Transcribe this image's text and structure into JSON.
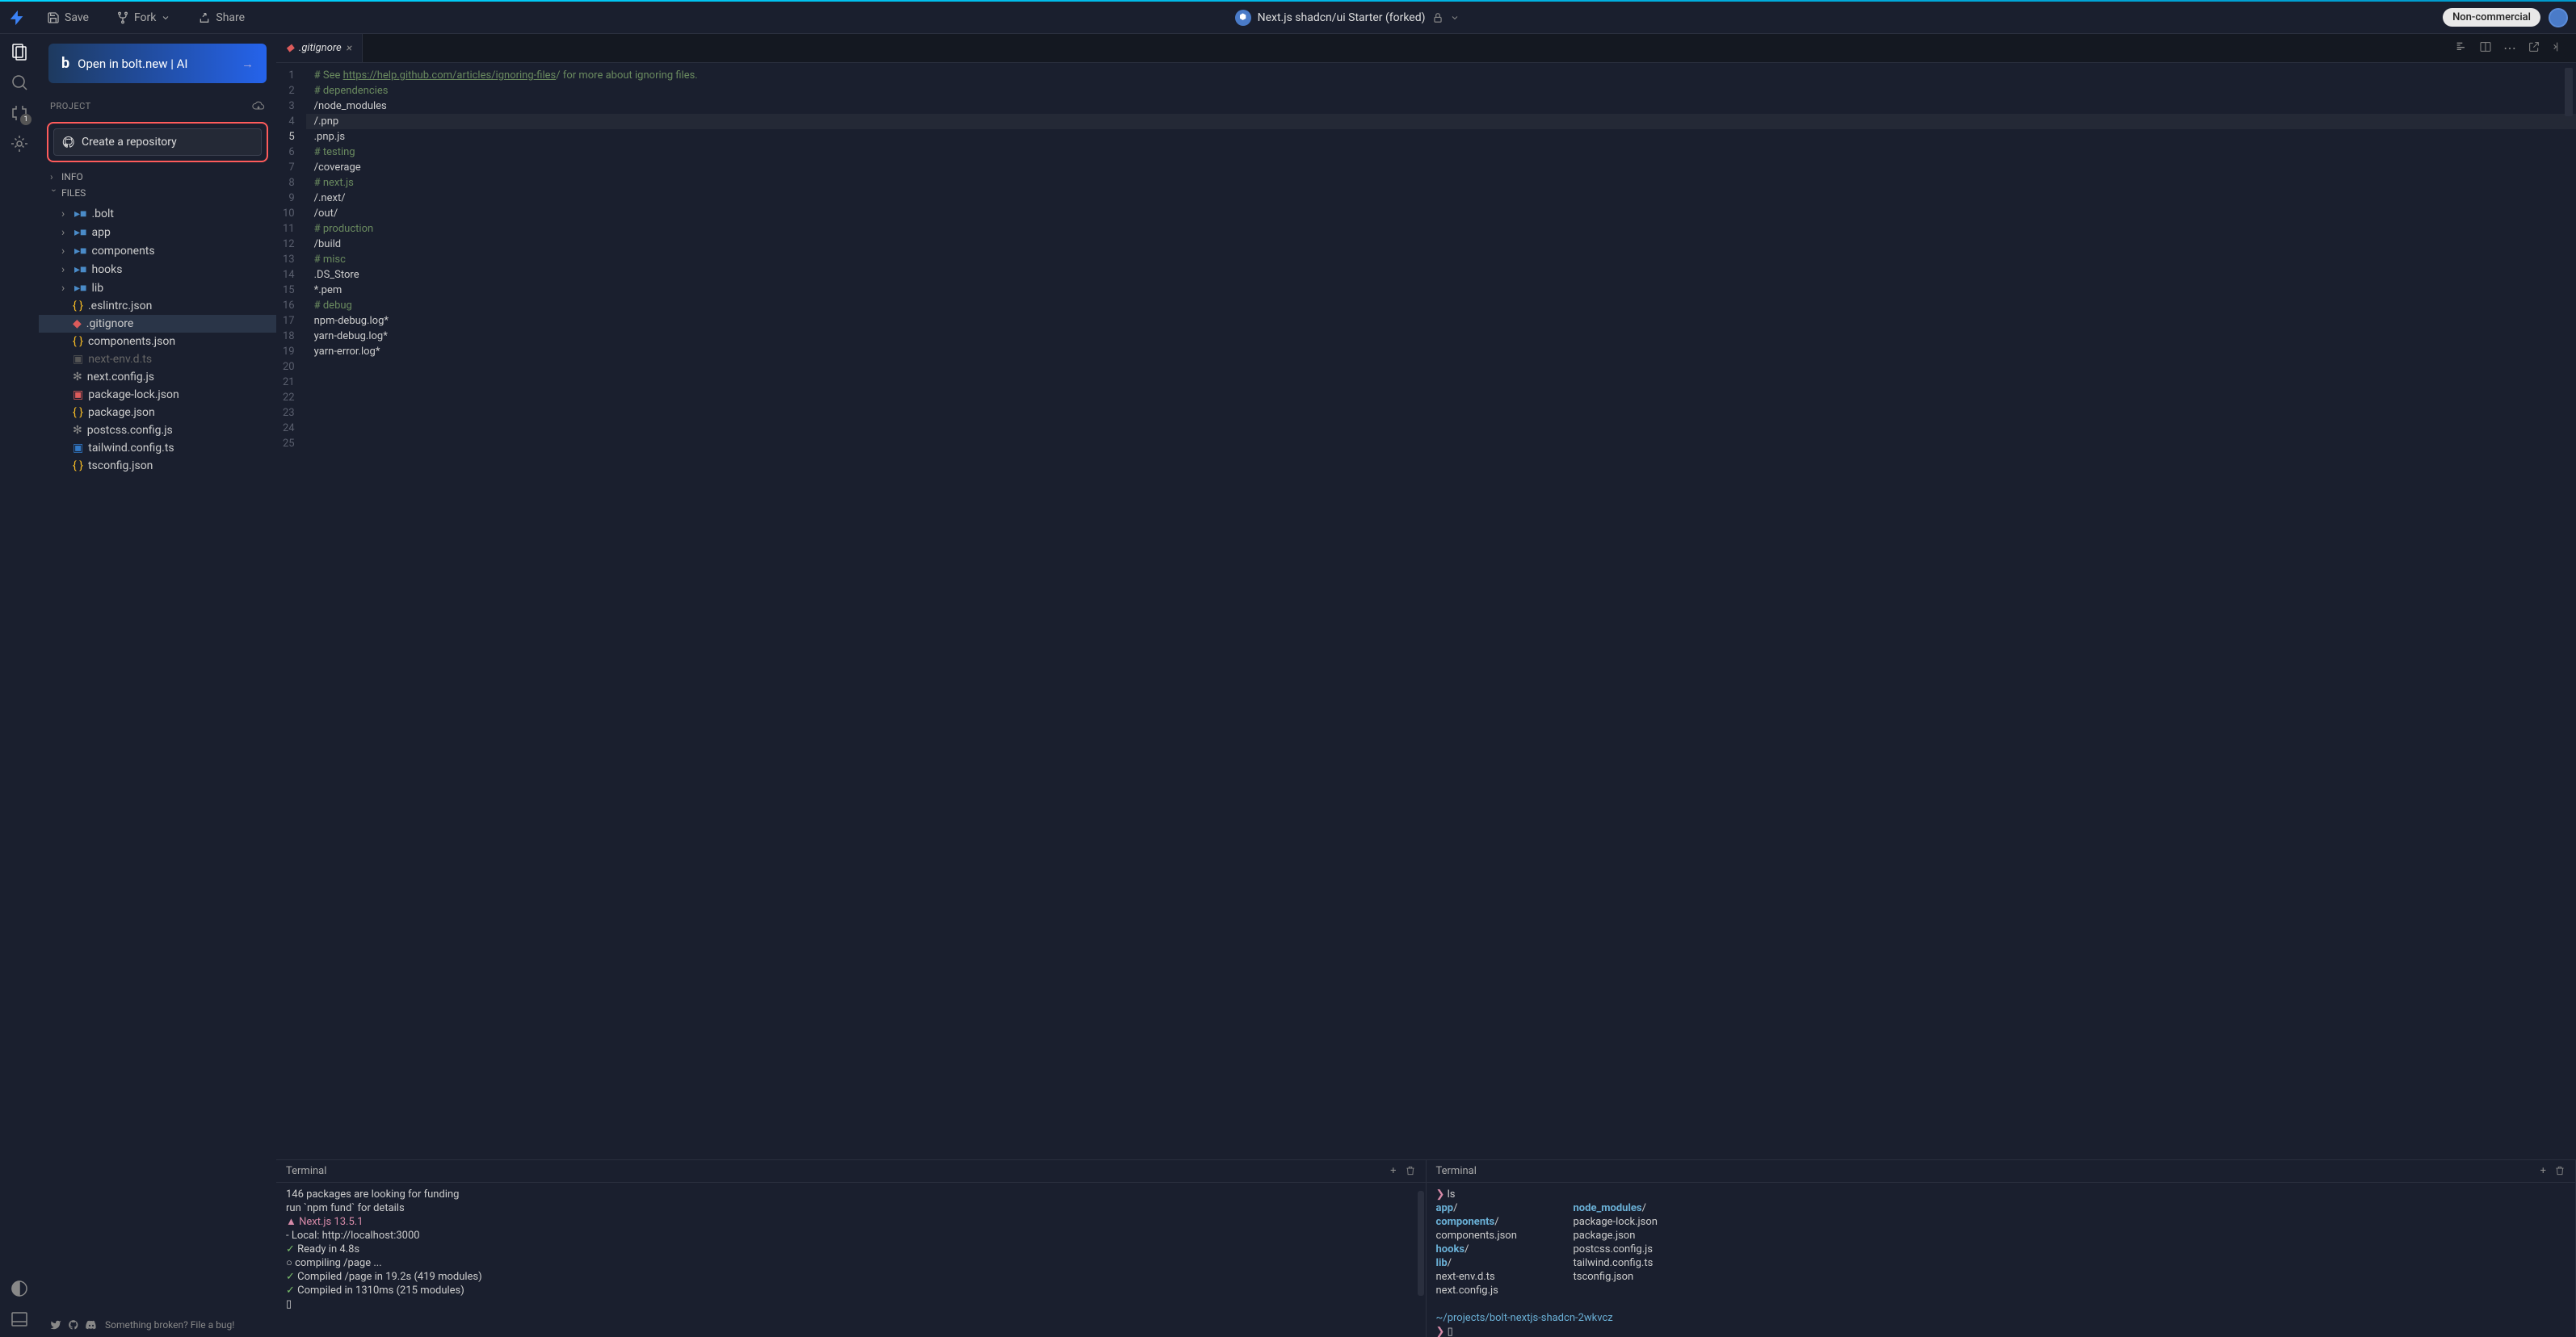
{
  "titlebar": {
    "save_label": "Save",
    "fork_label": "Fork",
    "share_label": "Share",
    "project_title": "Next.js shadcn/ui Starter (forked)",
    "badge": "Non-commercial"
  },
  "bolt_banner": {
    "label": "Open in bolt.new | AI"
  },
  "project": {
    "label": "PROJECT",
    "create_repo": "Create a repository",
    "info_label": "INFO",
    "files_label": "FILES"
  },
  "files": {
    "folders": [
      {
        "name": ".bolt"
      },
      {
        "name": "app"
      },
      {
        "name": "components"
      },
      {
        "name": "hooks"
      },
      {
        "name": "lib"
      }
    ],
    "files": [
      {
        "name": ".eslintrc.json",
        "icon": "json"
      },
      {
        "name": ".gitignore",
        "icon": "git",
        "selected": true
      },
      {
        "name": "components.json",
        "icon": "json"
      },
      {
        "name": "next-env.d.ts",
        "icon": "ts-dim",
        "dimmed": true
      },
      {
        "name": "next.config.js",
        "icon": "gear"
      },
      {
        "name": "package-lock.json",
        "icon": "lock"
      },
      {
        "name": "package.json",
        "icon": "json"
      },
      {
        "name": "postcss.config.js",
        "icon": "gear"
      },
      {
        "name": "tailwind.config.ts",
        "icon": "ts"
      },
      {
        "name": "tsconfig.json",
        "icon": "json"
      }
    ]
  },
  "footer": {
    "bug_link": "Something broken? File a bug!"
  },
  "tab": {
    "name": ".gitignore"
  },
  "editor": {
    "lines": [
      {
        "n": 1,
        "text": "# See https://help.github.com/articles/ignoring-files/ for more about ignoring files.",
        "comment": true,
        "link_start": 6,
        "link_end": 53
      },
      {
        "n": 2,
        "text": ""
      },
      {
        "n": 3,
        "text": "# dependencies",
        "comment": true
      },
      {
        "n": 4,
        "text": "/node_modules"
      },
      {
        "n": 5,
        "text": "/.pnp",
        "current": true
      },
      {
        "n": 6,
        "text": ".pnp.js"
      },
      {
        "n": 7,
        "text": ""
      },
      {
        "n": 8,
        "text": "# testing",
        "comment": true
      },
      {
        "n": 9,
        "text": "/coverage"
      },
      {
        "n": 10,
        "text": ""
      },
      {
        "n": 11,
        "text": "# next.js",
        "comment": true
      },
      {
        "n": 12,
        "text": "/.next/"
      },
      {
        "n": 13,
        "text": "/out/"
      },
      {
        "n": 14,
        "text": ""
      },
      {
        "n": 15,
        "text": "# production",
        "comment": true
      },
      {
        "n": 16,
        "text": "/build"
      },
      {
        "n": 17,
        "text": ""
      },
      {
        "n": 18,
        "text": "# misc",
        "comment": true
      },
      {
        "n": 19,
        "text": ".DS_Store"
      },
      {
        "n": 20,
        "text": "*.pem"
      },
      {
        "n": 21,
        "text": ""
      },
      {
        "n": 22,
        "text": "# debug",
        "comment": true
      },
      {
        "n": 23,
        "text": "npm-debug.log*"
      },
      {
        "n": 24,
        "text": "yarn-debug.log*"
      },
      {
        "n": 25,
        "text": "yarn-error.log*"
      }
    ]
  },
  "terminal_left": {
    "label": "Terminal",
    "lines": [
      {
        "text": "146 packages are looking for funding"
      },
      {
        "text": "  run `npm fund` for details"
      },
      {
        "segments": [
          {
            "t": "  ▲ ",
            "c": "pink"
          },
          {
            "t": "Next.js 13.5.1",
            "c": "pink"
          }
        ]
      },
      {
        "text": "  - Local:        http://localhost:3000"
      },
      {
        "text": ""
      },
      {
        "segments": [
          {
            "t": " ✓ ",
            "c": "green"
          },
          {
            "t": "Ready in 4.8s"
          }
        ]
      },
      {
        "segments": [
          {
            "t": " ○ "
          },
          {
            "t": "compiling /page ..."
          }
        ]
      },
      {
        "segments": [
          {
            "t": " ✓ ",
            "c": "green"
          },
          {
            "t": "Compiled /page in 19.2s (419 modules)"
          }
        ]
      },
      {
        "segments": [
          {
            "t": " ✓ ",
            "c": "green"
          },
          {
            "t": "Compiled in 1310ms (215 modules)"
          }
        ]
      },
      {
        "text": "▯"
      }
    ]
  },
  "terminal_right": {
    "label": "Terminal",
    "prompt": "❯",
    "ls_cmd": "ls",
    "ls_rows": [
      {
        "l": "app",
        "ldir": true,
        "ls": "/",
        "r": "node_modules",
        "rdir": true,
        "rs": "/"
      },
      {
        "l": "components",
        "ldir": true,
        "ls": "/",
        "r": "package-lock.json"
      },
      {
        "l": "components.json",
        "r": "package.json"
      },
      {
        "l": "hooks",
        "ldir": true,
        "ls": "/",
        "r": "postcss.config.js"
      },
      {
        "l": "lib",
        "ldir": true,
        "ls": "/",
        "r": "tailwind.config.ts"
      },
      {
        "l": "next-env.d.ts",
        "r": "tsconfig.json"
      },
      {
        "l": "next.config.js",
        "r": ""
      }
    ],
    "cwd": "~/projects/bolt-nextjs-shadcn-2wkvcz"
  },
  "activity_badge": "1"
}
